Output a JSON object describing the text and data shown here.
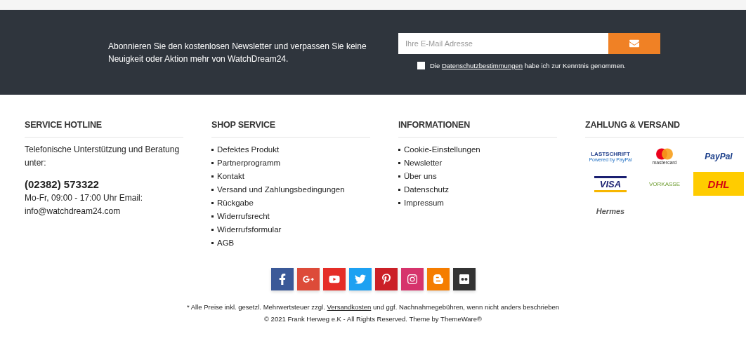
{
  "newsletter": {
    "text": "Abonnieren Sie den kostenlosen Newsletter und verpassen Sie keine Neuigkeit oder Aktion mehr von WatchDream24.",
    "placeholder": "Ihre E-Mail Adresse",
    "consent": {
      "checked": false,
      "before": "Die",
      "link": "Datenschutzbestimmungen",
      "after": "habe ich zur Kenntnis genommen."
    }
  },
  "columns": [
    {
      "title": "SERVICE HOTLINE",
      "kind": "hotline",
      "intro": "Telefonische Unterstützung und Beratung unter:",
      "phone": "(02382) 573322",
      "hours": "Mo-Fr, 09:00 - 17:00 Uhr Email:",
      "email": "info@watchdream24.com"
    },
    {
      "title": "SHOP SERVICE",
      "kind": "links",
      "items": [
        "Defektes Produkt",
        "Partnerprogramm",
        "Kontakt",
        "Versand und Zahlungsbedingungen",
        "Rückgabe",
        "Widerrufsrecht",
        "Widerrufsformular",
        "AGB"
      ]
    },
    {
      "title": "INFORMATIONEN",
      "kind": "links",
      "items": [
        "Cookie-Einstellungen",
        "Newsletter",
        "Über uns",
        "Datenschutz",
        "Impressum"
      ]
    },
    {
      "title": "ZAHLUNG & VERSAND",
      "kind": "payments",
      "items": [
        {
          "kind": "lastschrift",
          "label": "LASTSCHRIFT",
          "sublabel": "Powered by PayPal"
        },
        {
          "kind": "mastercard",
          "label": "mastercard"
        },
        {
          "kind": "paypal",
          "label": "PayPal"
        },
        {
          "kind": "visa",
          "label": "VISA"
        },
        {
          "kind": "vorkasse",
          "label": "VORKASSE"
        },
        {
          "kind": "dhl",
          "label": "DHL"
        },
        {
          "kind": "hermes",
          "label": "Hermes"
        }
      ]
    }
  ],
  "social": [
    {
      "kind": "facebook",
      "color": "#3b5998"
    },
    {
      "kind": "googleplus",
      "color": "#dd4b39"
    },
    {
      "kind": "youtube",
      "color": "#e52d27"
    },
    {
      "kind": "twitter",
      "color": "#1da1f2"
    },
    {
      "kind": "pinterest",
      "color": "#cb2027"
    },
    {
      "kind": "instagram",
      "color": "#d6336c"
    },
    {
      "kind": "blogger",
      "color": "#f57d00"
    },
    {
      "kind": "flickr",
      "color": "#333333"
    }
  ],
  "legal": {
    "before": "* Alle Preise inkl. gesetzl. Mehrwertsteuer zzgl.",
    "link": "Versandkosten",
    "after": "und ggf. Nachnahmegebühren, wenn nicht anders beschrieben"
  },
  "copyright": "© 2021 Frank Herweg e.K - All Rights Reserved. Theme by ThemeWare®"
}
